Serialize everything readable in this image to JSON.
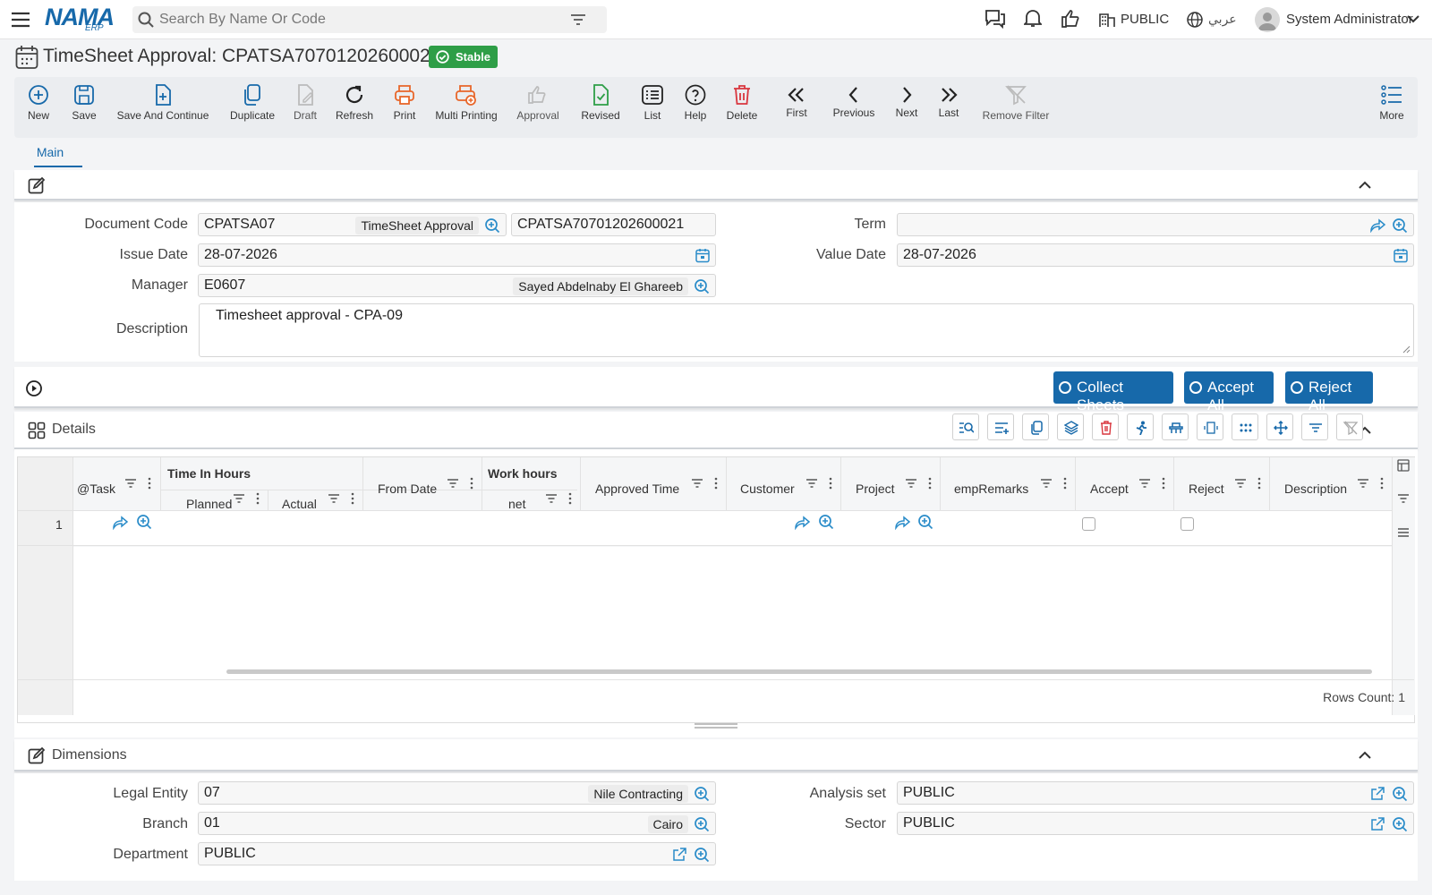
{
  "topbar": {
    "logo": "NAMA",
    "logo_sub": "ERP",
    "search_placeholder": "Search By Name Or Code",
    "branch": "PUBLIC",
    "language": "عربي",
    "user": "System Administrator"
  },
  "page": {
    "title": "TimeSheet Approval: CPATSA70701202600021",
    "status": "Stable"
  },
  "toolbar": {
    "new": "New",
    "save": "Save",
    "save_continue": "Save And Continue",
    "duplicate": "Duplicate",
    "draft": "Draft",
    "refresh": "Refresh",
    "print": "Print",
    "multi_printing": "Multi Printing",
    "approval": "Approval",
    "revised": "Revised",
    "list": "List",
    "help": "Help",
    "delete": "Delete",
    "first": "First",
    "previous": "Previous",
    "next": "Next",
    "last": "Last",
    "remove_filter": "Remove Filter",
    "more": "More"
  },
  "tabs": {
    "main": "Main"
  },
  "form": {
    "document_code_label": "Document Code",
    "document_code": "CPATSA07",
    "document_code_name": "TimeSheet Approval",
    "document_number": "CPATSA70701202600021",
    "term_label": "Term",
    "term": "",
    "issue_date_label": "Issue Date",
    "issue_date": "28-07-2026",
    "value_date_label": "Value Date",
    "value_date": "28-07-2026",
    "manager_label": "Manager",
    "manager_code": "E0607",
    "manager_name": "Sayed Abdelnaby El Ghareeb",
    "description_label": "Description",
    "description": "Timesheet approval - CPA-09"
  },
  "actions": {
    "collect_sheets": "Collect Sheets",
    "accept_all": "Accept All",
    "reject_all": "Reject All"
  },
  "details": {
    "title": "Details",
    "columns": {
      "task": "@Task",
      "time_in_hours": "Time In Hours",
      "planned": "Planned",
      "actual": "Actual",
      "from_date": "From Date",
      "work_hours": "Work hours",
      "net": "net",
      "approved_time": "Approved Time",
      "customer": "Customer",
      "project": "Project",
      "emp_remarks": "empRemarks",
      "accept": "Accept",
      "reject": "Reject",
      "description": "Description"
    },
    "rows": [
      {
        "num": "1",
        "task": "",
        "planned": "",
        "actual": "",
        "from_date": "",
        "net": "",
        "approved_time": "",
        "customer": "",
        "project": "",
        "emp_remarks": "",
        "accept": false,
        "reject": false,
        "description": ""
      }
    ],
    "rows_count": "Rows Count: 1"
  },
  "dimensions": {
    "title": "Dimensions",
    "legal_entity_label": "Legal Entity",
    "legal_entity_code": "07",
    "legal_entity_name": "Nile Contracting",
    "analysis_set_label": "Analysis set",
    "analysis_set": "PUBLIC",
    "branch_label": "Branch",
    "branch_code": "01",
    "branch_name": "Cairo",
    "sector_label": "Sector",
    "sector": "PUBLIC",
    "department_label": "Department",
    "department": "PUBLIC"
  },
  "colors": {
    "accent": "#1769aa",
    "status_green": "#2e9e47",
    "print_orange": "#e8662a",
    "delete_red": "#d9363e",
    "link_blue": "#2a8cc9"
  }
}
